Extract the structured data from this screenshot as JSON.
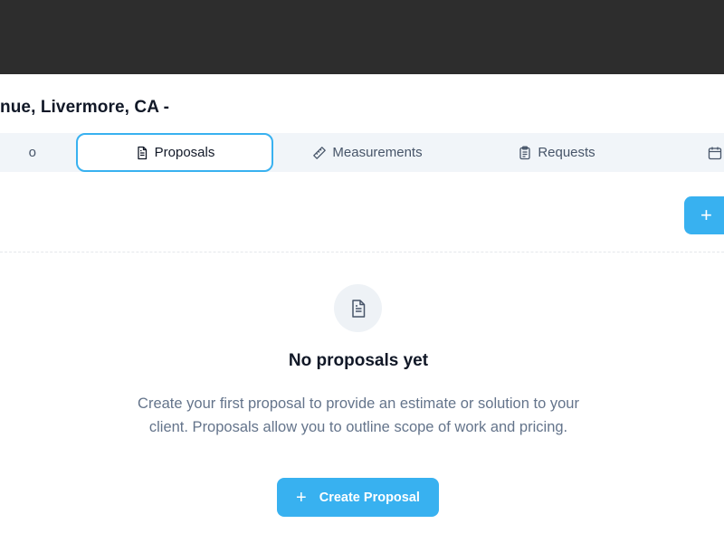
{
  "header": {
    "address": "nue, Livermore, CA -"
  },
  "tabs": [
    {
      "label": "o",
      "icon": "none",
      "active": false
    },
    {
      "label": "Proposals",
      "icon": "document-icon",
      "active": true
    },
    {
      "label": "Measurements",
      "icon": "ruler-icon",
      "active": false
    },
    {
      "label": "Requests",
      "icon": "clipboard-icon",
      "active": false
    },
    {
      "label": "",
      "icon": "calendar-icon",
      "active": false
    }
  ],
  "toolbar": {
    "add_label": "+"
  },
  "empty_state": {
    "icon": "document-icon",
    "title": "No proposals yet",
    "description": "Create your first proposal to provide an estimate or solution to your client. Proposals allow you to outline scope of work and pricing.",
    "button_plus": "+",
    "button_label": "Create Proposal"
  },
  "colors": {
    "accent": "#38b1f0",
    "topbar": "#2d2d2d",
    "tabbar": "#f1f5f9",
    "muted_text": "#64748b"
  }
}
